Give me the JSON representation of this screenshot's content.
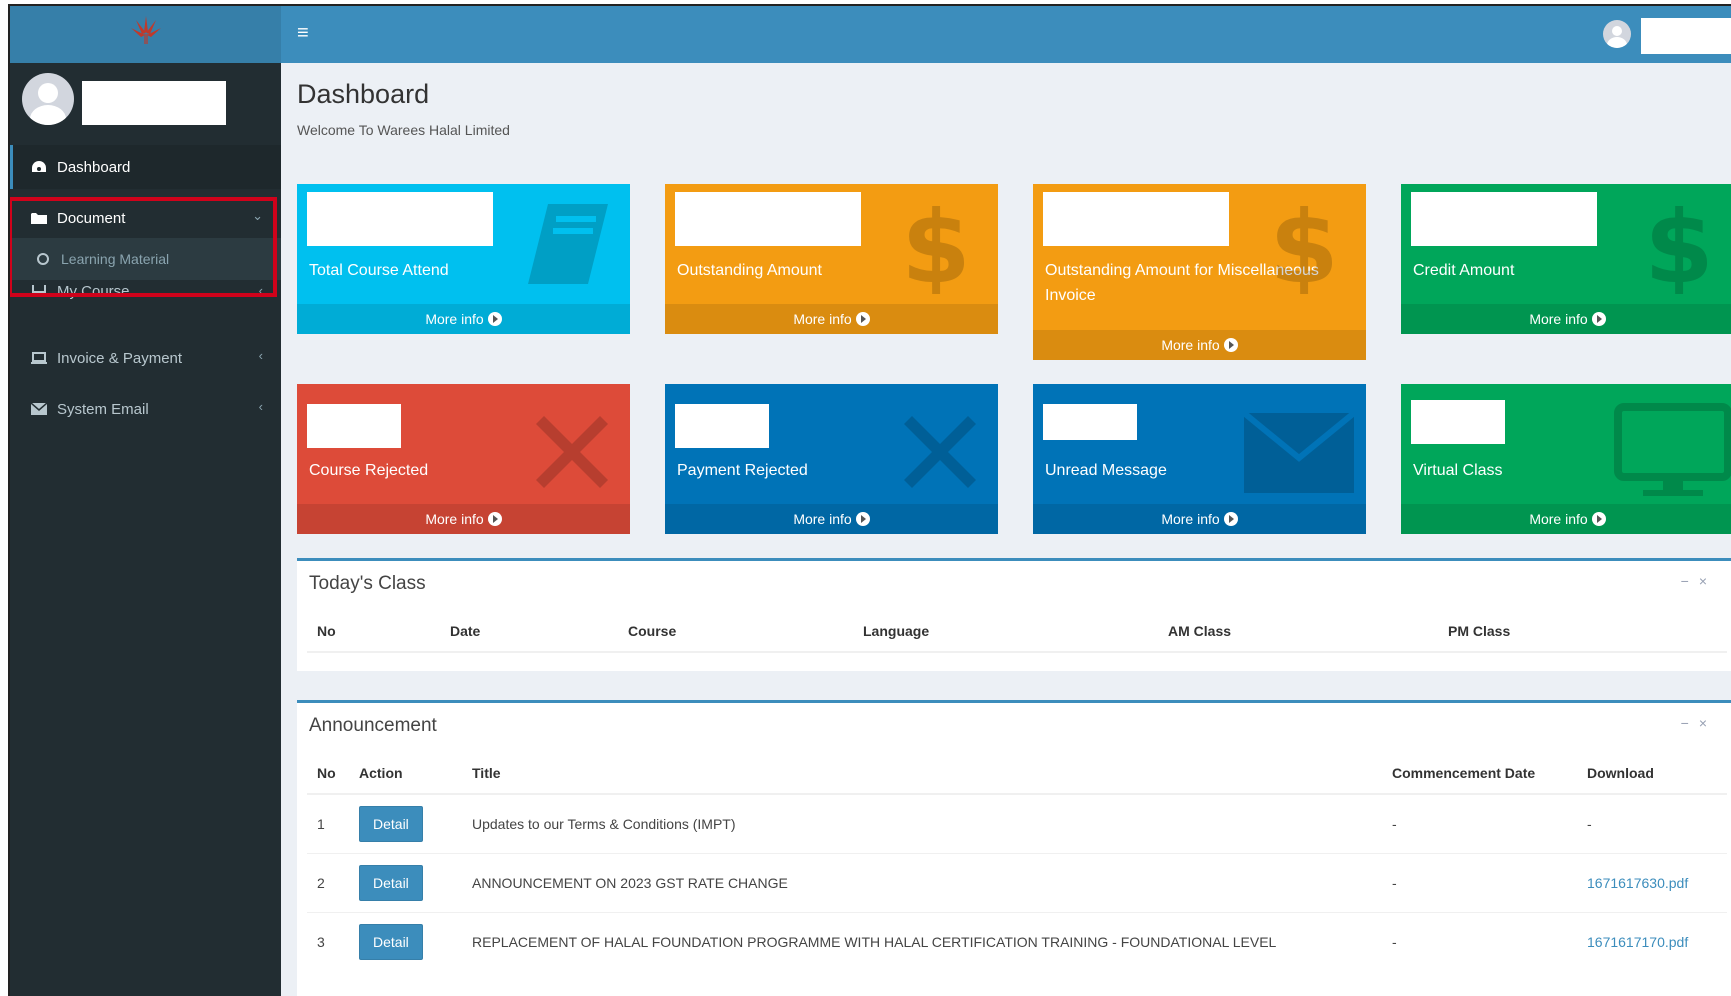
{
  "sidebar": {
    "items": [
      {
        "label": "Dashboard",
        "icon": "dashboard-icon"
      },
      {
        "label": "Document",
        "icon": "folder-icon",
        "expanded": true
      },
      {
        "label": "Learning Material",
        "icon": "circle-icon"
      },
      {
        "label": "My Course",
        "icon": "laptop-icon"
      },
      {
        "label": "Invoice & Payment",
        "icon": "laptop-icon"
      },
      {
        "label": "System Email",
        "icon": "envelope-icon"
      }
    ]
  },
  "header": {
    "menu_icon": "hamburger-icon"
  },
  "page": {
    "title": "Dashboard",
    "subtitle": "Welcome To Warees Halal Limited"
  },
  "tiles": [
    {
      "label": "Total Course Attend",
      "footer": "More info",
      "color": "#00c0ef",
      "icon": "book-icon"
    },
    {
      "label": "Outstanding Amount",
      "footer": "More info",
      "color": "#f39c12",
      "icon": "dollar-icon"
    },
    {
      "label": "Outstanding Amount for Miscellaneous Invoice",
      "footer": "More info",
      "color": "#f39c12",
      "icon": "dollar-icon"
    },
    {
      "label": "Credit Amount",
      "footer": "More info",
      "color": "#00a65a",
      "icon": "dollar-icon"
    },
    {
      "label": "Course Rejected",
      "footer": "More info",
      "color": "#dd4b39",
      "icon": "cross-icon"
    },
    {
      "label": "Payment Rejected",
      "footer": "More info",
      "color": "#0073b7",
      "icon": "cross-icon"
    },
    {
      "label": "Unread Message",
      "footer": "More info",
      "color": "#0073b7",
      "icon": "envelope-icon"
    },
    {
      "label": "Virtual Class",
      "footer": "More info",
      "color": "#00a65a",
      "icon": "monitor-icon"
    }
  ],
  "todays_class": {
    "title": "Today's Class",
    "columns": [
      "No",
      "Date",
      "Course",
      "Language",
      "AM Class",
      "PM Class"
    ]
  },
  "announcement": {
    "title": "Announcement",
    "columns": [
      "No",
      "Action",
      "Title",
      "Commencement Date",
      "Download"
    ],
    "rows": [
      {
        "no": "1",
        "action": "Detail",
        "title": "Updates to our Terms & Conditions (IMPT)",
        "date": "-",
        "download": "-"
      },
      {
        "no": "2",
        "action": "Detail",
        "title": "ANNOUNCEMENT ON 2023 GST RATE CHANGE",
        "date": "-",
        "download": "1671617630.pdf"
      },
      {
        "no": "3",
        "action": "Detail",
        "title": "REPLACEMENT OF HALAL FOUNDATION PROGRAMME WITH HALAL CERTIFICATION TRAINING - FOUNDATIONAL LEVEL",
        "date": "-",
        "download": "1671617170.pdf"
      }
    ]
  },
  "panel_tools": {
    "collapse": "−",
    "close": "×"
  },
  "colors": {
    "sidebar": "#222d32",
    "header": "#3c8dbc",
    "highlight": "#d0021b"
  }
}
